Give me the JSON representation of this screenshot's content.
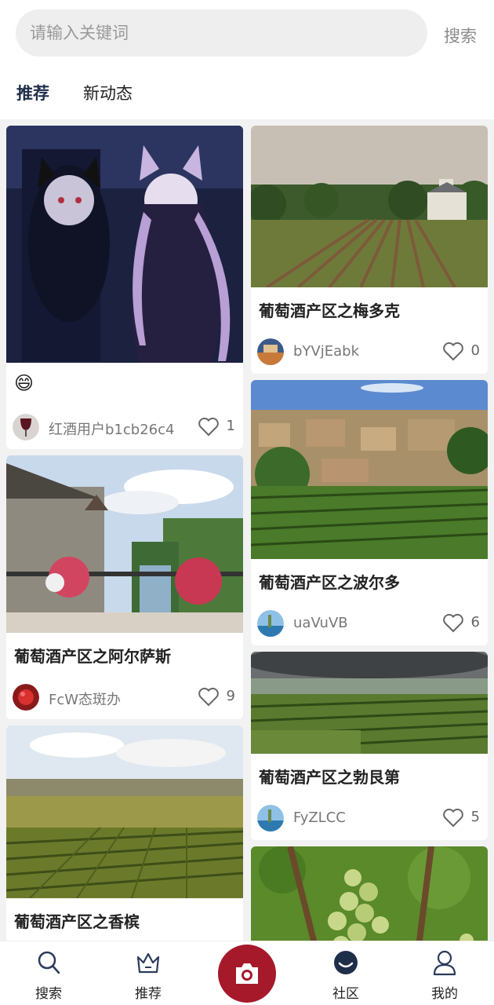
{
  "search": {
    "placeholder": "请输入关键词",
    "button_label": "搜索"
  },
  "tabs": [
    {
      "label": "推荐",
      "active": true
    },
    {
      "label": "新动态",
      "active": false
    }
  ],
  "feed": {
    "left": [
      {
        "emoji": "😄",
        "user": "红酒用户b1cb26c4",
        "likes": "1"
      },
      {
        "title": "葡萄酒产区之阿尔萨斯",
        "user": "FcW态斑办",
        "likes": "9"
      },
      {
        "title": "葡萄酒产区之香槟"
      }
    ],
    "right": [
      {
        "title": "葡萄酒产区之梅多克",
        "user": "bYVjEabk",
        "likes": "0"
      },
      {
        "title": "葡萄酒产区之波尔多",
        "user": "uaVuVB",
        "likes": "6"
      },
      {
        "title": "葡萄酒产区之勃艮第",
        "user": "FyZLCC",
        "likes": "5"
      },
      {
        "title": ""
      }
    ]
  },
  "bottom_nav": [
    {
      "label": "搜索",
      "icon": "search-icon"
    },
    {
      "label": "推荐",
      "icon": "crown-icon"
    },
    {
      "label": "",
      "icon": "camera-icon"
    },
    {
      "label": "社区",
      "icon": "community-icon"
    },
    {
      "label": "我的",
      "icon": "user-icon"
    }
  ],
  "colors": {
    "accent": "#a5192b",
    "active_tab": "#1f2e49",
    "background": "#f2f2f2"
  }
}
